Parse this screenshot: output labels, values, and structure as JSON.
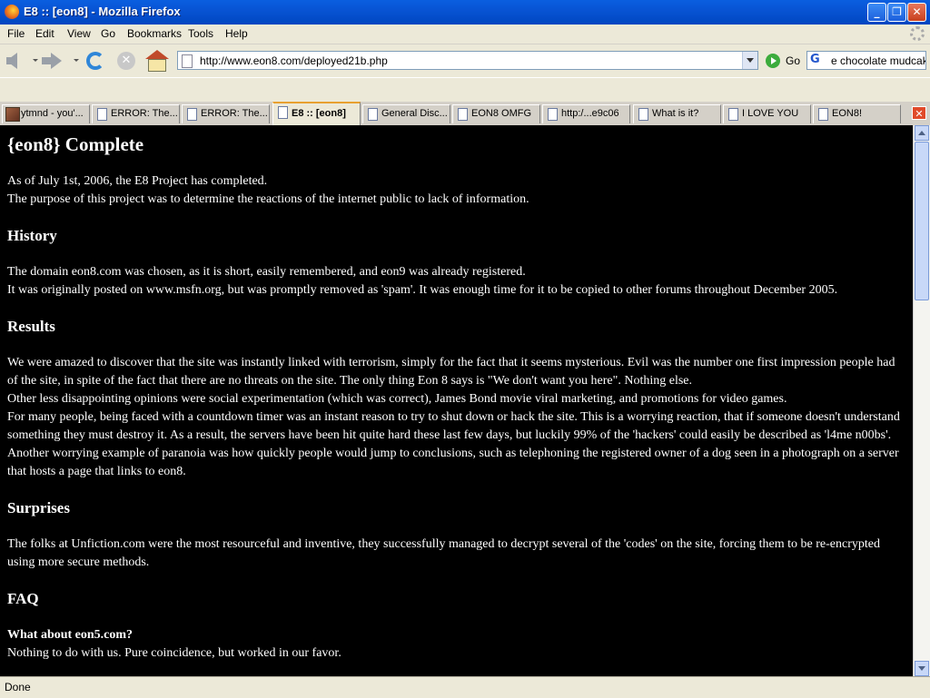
{
  "window": {
    "title": "E8 :: [eon8] - Mozilla Firefox"
  },
  "menu": [
    "File",
    "Edit",
    "View",
    "Go",
    "Bookmarks",
    "Tools",
    "Help"
  ],
  "nav": {
    "url": "http://www.eon8.com/deployed21b.php",
    "go_label": "Go",
    "search_value": "e chocolate mudcake"
  },
  "tabs": [
    {
      "label": "ytmnd - you'..."
    },
    {
      "label": "ERROR: The..."
    },
    {
      "label": "ERROR: The..."
    },
    {
      "label": "E8 :: [eon8]"
    },
    {
      "label": "General Disc..."
    },
    {
      "label": "EON8 OMFG"
    },
    {
      "label": "http:/...e9c06"
    },
    {
      "label": "What is it?"
    },
    {
      "label": "I LOVE YOU"
    },
    {
      "label": "EON8!"
    }
  ],
  "page": {
    "title": "{eon8} Complete",
    "intro": [
      "As of July 1st, 2006, the E8 Project has completed.",
      "The purpose of this project was to determine the reactions of the internet public to lack of information."
    ],
    "history_heading": "History",
    "history": [
      "The domain eon8.com was chosen, as it is short, easily remembered, and eon9 was already registered.",
      "It was originally posted on www.msfn.org, but was promptly removed as 'spam'. It was enough time for it to be copied to other forums throughout December 2005."
    ],
    "results_heading": "Results",
    "results": [
      "We were amazed to discover that the site was instantly linked with terrorism, simply for the fact that it seems mysterious. Evil was the number one first impression people had of the site, in spite of the fact that there are no threats on the site. The only thing Eon 8 says is \"We don't want you here\". Nothing else.",
      "Other less disappointing opinions were social experimentation (which was correct), James Bond movie viral marketing, and promotions for video games.",
      "For many people, being faced with a countdown timer was an instant reason to try to shut down or hack the site. This is a worrying reaction, that if someone doesn't understand something they must destroy it. As a result, the servers have been hit quite hard these last few days, but luckily 99% of the 'hackers' could easily be described as 'l4me n00bs'.",
      "Another worrying example of paranoia was how quickly people would jump to conclusions, such as telephoning the registered owner of a dog seen in a photograph on a server that hosts a page that links to eon8."
    ],
    "surprises_heading": "Surprises",
    "surprises": [
      "The folks at Unfiction.com were the most resourceful and inventive, they successfully managed to decrypt several of the 'codes' on the site, forcing them to be re-encrypted using more secure methods."
    ],
    "faq_heading": "FAQ",
    "faq_q1": "What about eon5.com?",
    "faq_a1": "Nothing to do with us. Pure coincidence, but worked in our favor."
  },
  "status": {
    "text": "Done"
  }
}
